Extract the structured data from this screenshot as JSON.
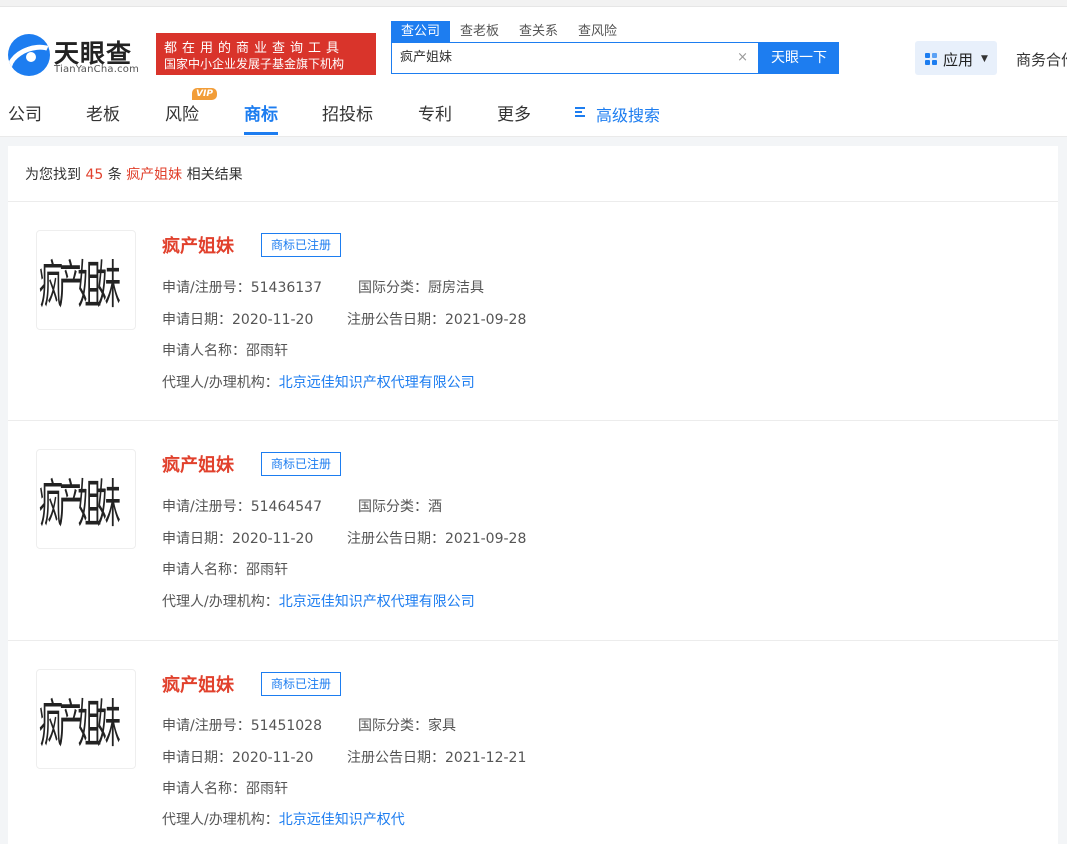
{
  "header": {
    "logo_text": "天眼查",
    "logo_sub": "TianYanCha.com",
    "slogan_line1": "都在用的商业查询工具",
    "slogan_line2": "国家中小企业发展子基金旗下机构",
    "search_tabs": [
      "查公司",
      "查老板",
      "查关系",
      "查风险"
    ],
    "search_value": "疯产姐妹",
    "search_button": "天眼一下",
    "apps_label": "应用",
    "biz_label": "商务合作"
  },
  "nav": {
    "items": [
      "公司",
      "老板",
      "风险",
      "商标",
      "招投标",
      "专利",
      "更多"
    ],
    "vip_badge": "VIP",
    "advanced_search": "高级搜索",
    "active": "商标"
  },
  "summary": {
    "prefix": "为您找到",
    "count": "45",
    "unit": "条",
    "keyword": "疯产姐妹",
    "suffix": "相关结果"
  },
  "labels": {
    "reg_no": "申请/注册号：",
    "intl_class": "国际分类：",
    "apply_date": "申请日期：",
    "announce_date": "注册公告日期：",
    "applicant": "申请人名称：",
    "agent": "代理人/办理机构："
  },
  "results": [
    {
      "name": "疯产姐妹",
      "status": "商标已注册",
      "image_text": "疯产姐妹",
      "reg_no": "51436137",
      "intl_class": "厨房洁具",
      "apply_date": "2020-11-20",
      "announce_date": "2021-09-28",
      "applicant": "邵雨轩",
      "agent": "北京远佳知识产权代理有限公司"
    },
    {
      "name": "疯产姐妹",
      "status": "商标已注册",
      "image_text": "疯产姐妹",
      "reg_no": "51464547",
      "intl_class": "酒",
      "apply_date": "2020-11-20",
      "announce_date": "2021-09-28",
      "applicant": "邵雨轩",
      "agent": "北京远佳知识产权代理有限公司"
    },
    {
      "name": "疯产姐妹",
      "status": "商标已注册",
      "image_text": "疯产姐妹",
      "reg_no": "51451028",
      "intl_class": "家具",
      "apply_date": "2020-11-20",
      "announce_date": "2021-12-21",
      "applicant": "邵雨轩",
      "agent": "北京远佳知识产权代"
    }
  ],
  "colors": {
    "accent": "#1d7df0",
    "brand_red": "#d9342b",
    "highlight": "#e1412d"
  }
}
